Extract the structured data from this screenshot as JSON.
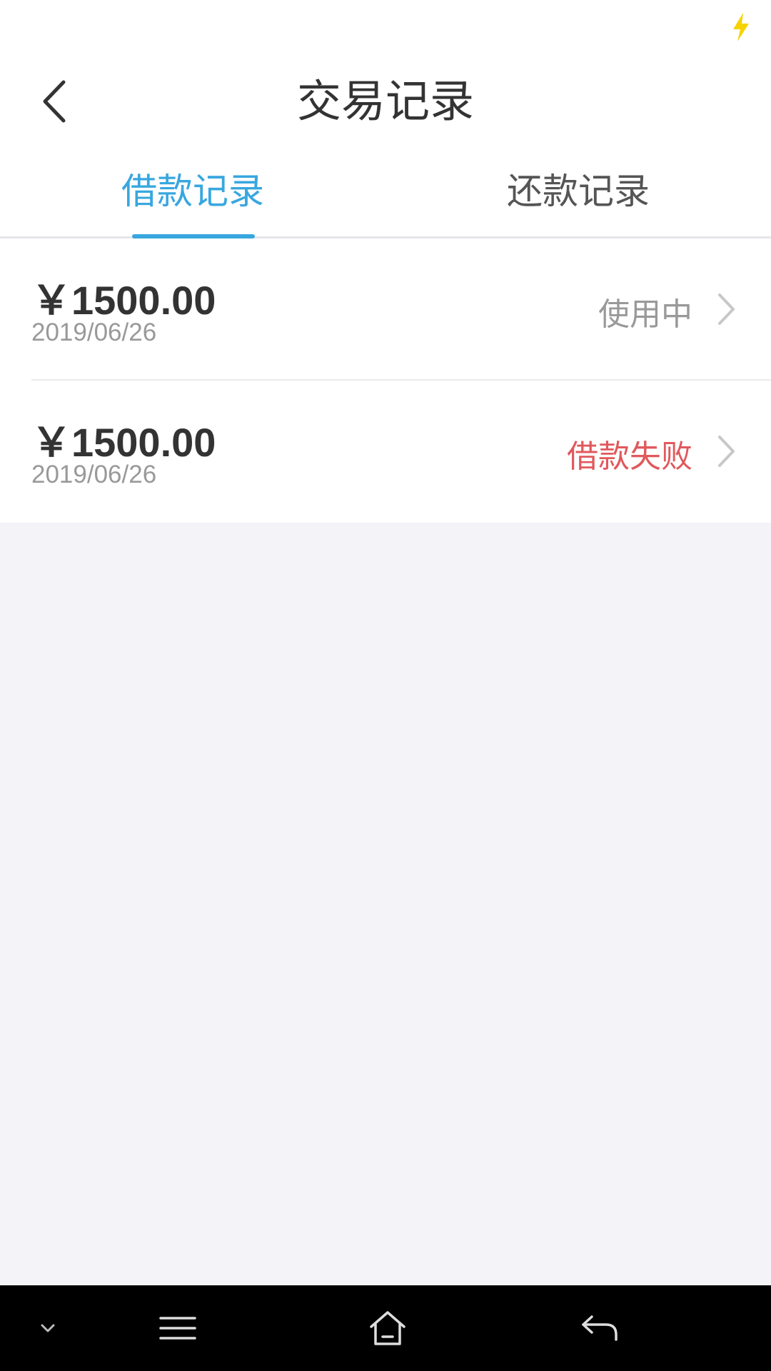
{
  "header": {
    "title": "交易记录"
  },
  "tabs": [
    {
      "label": "借款记录",
      "active": true
    },
    {
      "label": "还款记录",
      "active": false
    }
  ],
  "records": [
    {
      "amount": "￥1500.00",
      "date": "2019/06/26",
      "status": "使用中"
    },
    {
      "amount": "￥1500.00",
      "date": "2019/06/26",
      "status": "借款失败"
    }
  ],
  "colors": {
    "accent": "#38a7df",
    "failed": "#e0595d",
    "charging": "#f5d300"
  },
  "icons": {
    "status_bar": "charging-bolt-icon",
    "back": "chevron-left-icon",
    "row_arrow": "chevron-right-icon",
    "nav": [
      "collapse-down-icon",
      "menu-icon",
      "home-icon",
      "back-arrow-icon"
    ]
  }
}
